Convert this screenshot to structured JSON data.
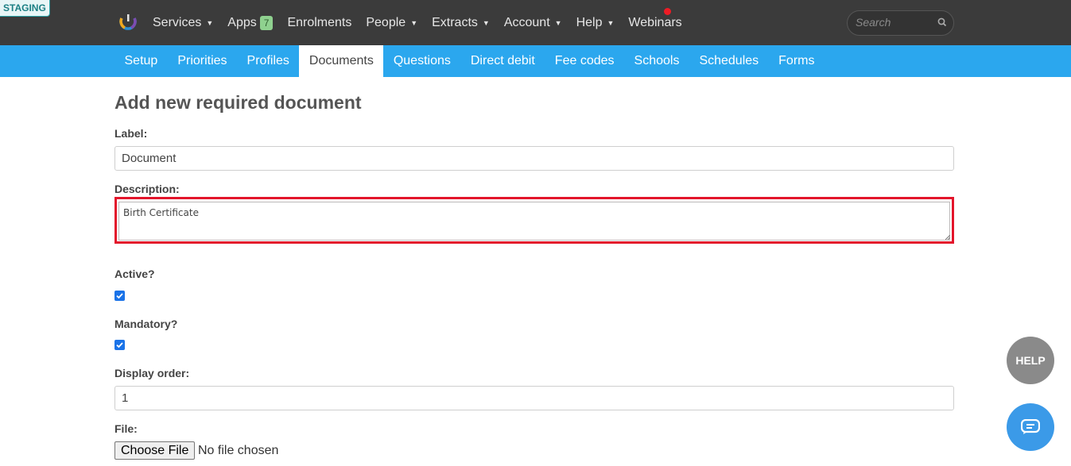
{
  "env_badge": "STAGING",
  "topnav": {
    "services": "Services",
    "apps": "Apps",
    "apps_count": "7",
    "enrolments": "Enrolments",
    "people": "People",
    "extracts": "Extracts",
    "account": "Account",
    "help": "Help",
    "webinars": "Webinars",
    "search_placeholder": "Search"
  },
  "subnav": {
    "tabs": [
      "Setup",
      "Priorities",
      "Profiles",
      "Documents",
      "Questions",
      "Direct debit",
      "Fee codes",
      "Schools",
      "Schedules",
      "Forms"
    ],
    "active": "Documents"
  },
  "form": {
    "title": "Add new required document",
    "label_label": "Label:",
    "label_value": "Document",
    "description_label": "Description:",
    "description_value": "Birth Certificate",
    "active_label": "Active?",
    "active_checked": true,
    "mandatory_label": "Mandatory?",
    "mandatory_checked": true,
    "display_order_label": "Display order:",
    "display_order_value": "1",
    "file_label": "File:",
    "file_button": "Choose File",
    "file_status": "No file chosen"
  },
  "widgets": {
    "help_label": "HELP"
  },
  "colors": {
    "topbar": "#3b3b3b",
    "subnav": "#2ba7ee",
    "highlight": "#e3152b",
    "notification": "#ee1c25"
  }
}
